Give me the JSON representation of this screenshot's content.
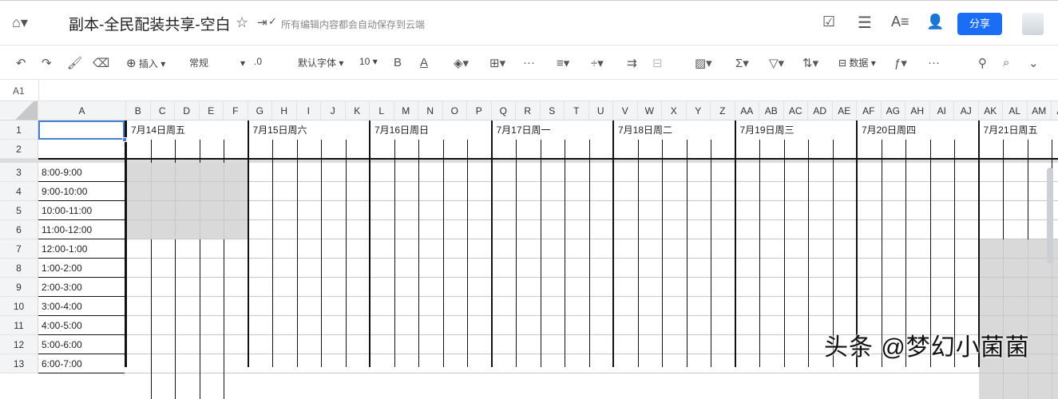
{
  "header": {
    "title": "副本-全民配装共享-空白",
    "save_status": "所有编辑内容都会自动保存到云端",
    "share_label": "分享"
  },
  "toolbar": {
    "insert_label": "插入",
    "format_value": "常规",
    "decimal": ".0",
    "font_value": "默认字体",
    "size_value": "10",
    "bold": "B",
    "font_color": "A",
    "data_label": "数据",
    "more": "···"
  },
  "formula_bar": {
    "cell_ref": "A1",
    "value": ""
  },
  "columns": [
    "A",
    "B",
    "C",
    "D",
    "E",
    "F",
    "G",
    "H",
    "I",
    "J",
    "K",
    "L",
    "M",
    "N",
    "O",
    "P",
    "Q",
    "R",
    "S",
    "T",
    "U",
    "V",
    "W",
    "X",
    "Y",
    "Z",
    "AA",
    "AB",
    "AC",
    "AD",
    "AE",
    "AF",
    "AG",
    "AH",
    "AI",
    "AJ",
    "AK",
    "AL",
    "AM",
    "AN"
  ],
  "rows": [
    "1",
    "2",
    "3",
    "4",
    "5",
    "6",
    "7",
    "8",
    "9",
    "10",
    "11",
    "12",
    "13"
  ],
  "days": [
    "7月14日周五",
    "7月15日周六",
    "7月16日周日",
    "7月17日周一",
    "7月18日周二",
    "7月19日周三",
    "7月20日周四",
    "7月21日周五"
  ],
  "times": [
    "8:00-9:00",
    "9:00-10:00",
    "10:00-11:00",
    "11:00-12:00",
    "12:00-1:00",
    "1:00-2:00",
    "2:00-3:00",
    "3:00-4:00",
    "4:00-5:00",
    "5:00-6:00",
    "6:00-7:00"
  ],
  "watermark": "头条 @梦幻小菌菌",
  "colors": {
    "accent": "#1a6ef5",
    "shaded": "#d9d9d9"
  }
}
